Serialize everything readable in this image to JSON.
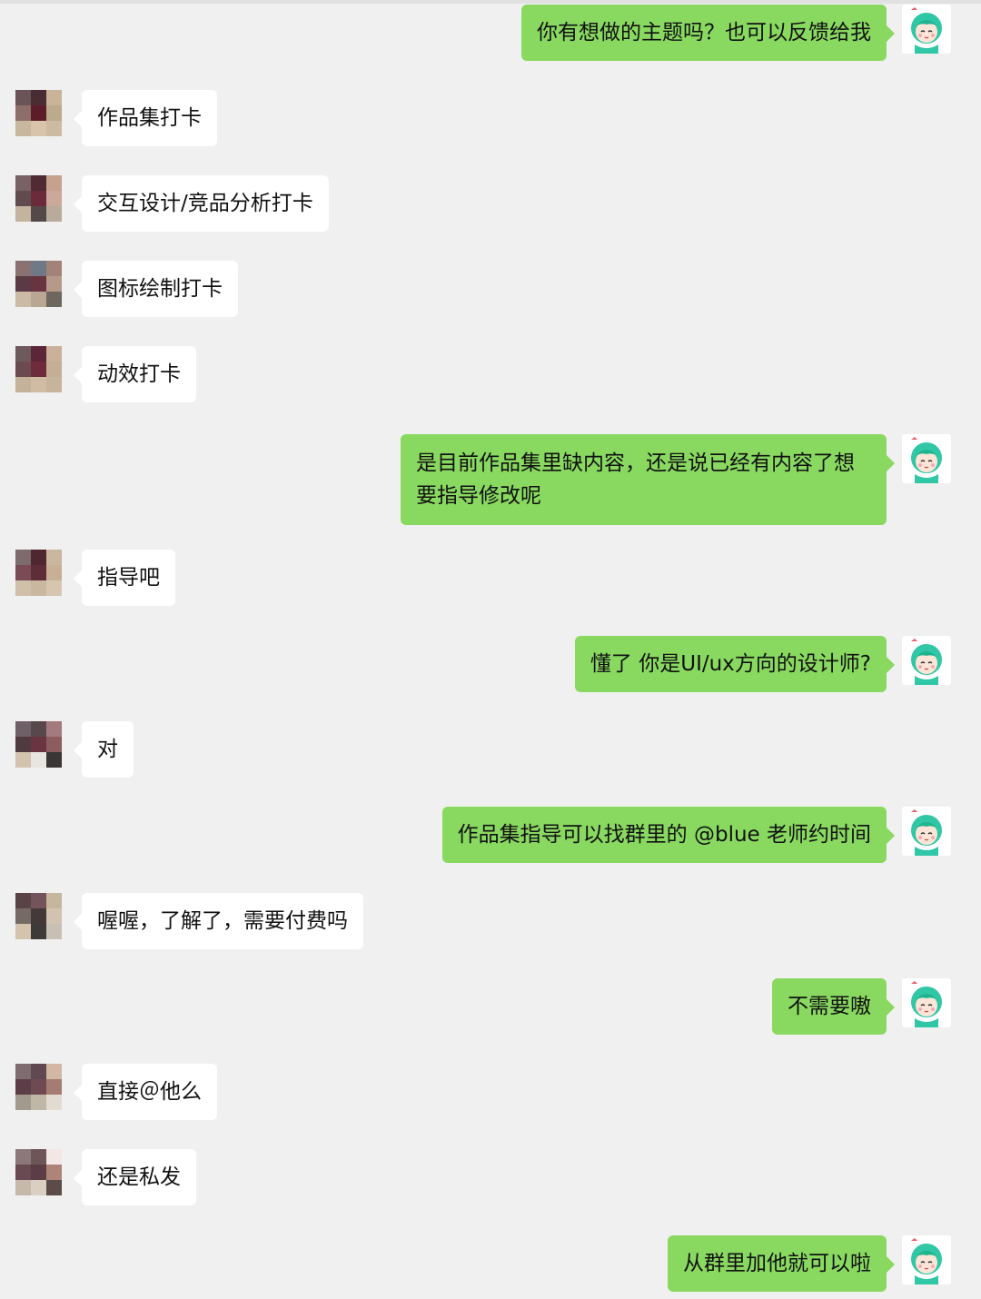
{
  "colors": {
    "background": "#f0f0f0",
    "incoming_bubble": "#ffffff",
    "outgoing_bubble": "#89d961",
    "text": "#111111"
  },
  "avatars": {
    "me_icon": "cartoon-green-hair-girl-icon",
    "contact_icon": "pixelated-mosaic-avatar-icon"
  },
  "messages": [
    {
      "from": "me",
      "text": "你有想做的主题吗？也可以反馈给我"
    },
    {
      "from": "contact",
      "text": "作品集打卡"
    },
    {
      "from": "contact",
      "text": "交互设计/竞品分析打卡"
    },
    {
      "from": "contact",
      "text": "图标绘制打卡"
    },
    {
      "from": "contact",
      "text": "动效打卡"
    },
    {
      "from": "me",
      "text": "是目前作品集里缺内容，还是说已经有内容了想要指导修改呢"
    },
    {
      "from": "contact",
      "text": "指导吧"
    },
    {
      "from": "me",
      "text": "懂了 你是UI/ux方向的设计师?"
    },
    {
      "from": "contact",
      "text": "对"
    },
    {
      "from": "me",
      "text": "作品集指导可以找群里的 @blue 老师约时间"
    },
    {
      "from": "contact",
      "text": "喔喔，了解了，需要付费吗"
    },
    {
      "from": "me",
      "text": "不需要嗷"
    },
    {
      "from": "contact",
      "text": "直接＠他么"
    },
    {
      "from": "contact",
      "text": "还是私发"
    },
    {
      "from": "me",
      "text": "从群里加他就可以啦"
    }
  ]
}
